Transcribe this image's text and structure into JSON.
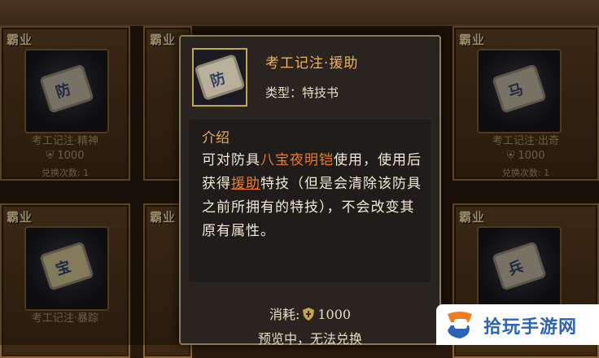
{
  "cards": [
    {
      "tag": "霸业",
      "name": "考工记注·精神",
      "price": "1000",
      "count": "兑换次数: 1",
      "glyph": "防"
    },
    {
      "tag": "霸业",
      "name": "",
      "price": "",
      "count": "",
      "glyph": ""
    },
    {
      "tag": "霸业",
      "name": "考工记注·出奇",
      "price": "1000",
      "count": "兑换次数: 1",
      "glyph": "马"
    },
    {
      "tag": "霸业",
      "name": "考工记注·暴踪",
      "price": "",
      "count": "",
      "glyph": "宝"
    },
    {
      "tag": "霸业",
      "name": "",
      "price": "",
      "count": "",
      "glyph": ""
    },
    {
      "tag": "霸业",
      "name": "",
      "price": "",
      "count": "",
      "glyph": "兵"
    }
  ],
  "tooltip": {
    "icon_glyph": "防",
    "title": "考工记注·援助",
    "type": "类型：特技书",
    "intro_label": "介绍",
    "desc_p1": "可对防具",
    "desc_item": "八宝夜明铠",
    "desc_p2": "使用，使用后获得",
    "desc_skill": "援助",
    "desc_p3": "特技（但是会清除该防具之前所拥有的特技），不会改变其原有属性。",
    "cost_label": "消耗:",
    "cost_value": "1000",
    "status": "预览中，无法兑换"
  },
  "watermark": {
    "text": "拾玩手游网"
  },
  "colors": {
    "highlight": "#ee7b2a",
    "title": "#f0b25a",
    "frame": "#8a6636"
  }
}
